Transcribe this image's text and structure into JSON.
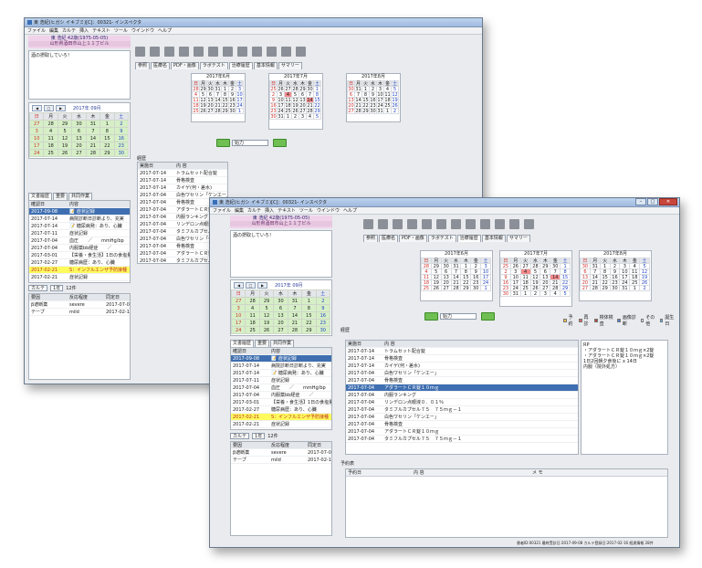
{
  "window": {
    "title": "東 浩紀(ヒガシ イキブミ)[C]：00321- インスペクタ"
  },
  "menu": [
    "ファイル",
    "編集",
    "カルテ",
    "挿入",
    "テキスト",
    "ツール",
    "ウインドウ",
    "ヘルプ"
  ],
  "patient": {
    "name": "東 浩紀 42歳(1975-05-05)",
    "address": "山形県酒田市山上１１丁ビル"
  },
  "memo": "酒の摂取していろ！",
  "tabs": [
    "参照",
    "医療名",
    "PDF・画像",
    "ラボテスト",
    "治療履歴",
    "基本情報",
    "サマリー"
  ],
  "calendar_months": [
    {
      "title": "2017年6月",
      "days": [
        [
          "28",
          "29",
          "30",
          "31",
          "1",
          "2",
          "3"
        ],
        [
          "4",
          "5",
          "6",
          "7",
          "8",
          "9",
          "10"
        ],
        [
          "11",
          "12",
          "13",
          "14",
          "15",
          "16",
          "17"
        ],
        [
          "18",
          "19",
          "20",
          "21",
          "22",
          "23",
          "24"
        ],
        [
          "25",
          "26",
          "27",
          "28",
          "29",
          "30",
          "1"
        ]
      ]
    },
    {
      "title": "2017年7月",
      "days": [
        [
          "25",
          "26",
          "27",
          "28",
          "29",
          "30",
          "1"
        ],
        [
          "2",
          "3",
          "4",
          "5",
          "6",
          "7",
          "8"
        ],
        [
          "9",
          "10",
          "11",
          "12",
          "13",
          "14",
          "15"
        ],
        [
          "16",
          "17",
          "18",
          "19",
          "20",
          "21",
          "22"
        ],
        [
          "23",
          "24",
          "25",
          "26",
          "27",
          "28",
          "29"
        ],
        [
          "30",
          "31",
          "1",
          "2",
          "3",
          "4",
          "5"
        ]
      ]
    },
    {
      "title": "2017年8月",
      "days": [
        [
          "30",
          "31",
          "1",
          "2",
          "3",
          "4",
          "5"
        ],
        [
          "6",
          "7",
          "8",
          "9",
          "10",
          "11",
          "12"
        ],
        [
          "13",
          "14",
          "15",
          "16",
          "17",
          "18",
          "19"
        ],
        [
          "20",
          "21",
          "22",
          "23",
          "24",
          "25",
          "26"
        ],
        [
          "27",
          "28",
          "29",
          "30",
          "31",
          "1",
          "2"
        ]
      ]
    }
  ],
  "weekdays": [
    "日",
    "月",
    "火",
    "水",
    "木",
    "金",
    "土"
  ],
  "side_calendar": {
    "title": "2017年 09月",
    "days": [
      [
        "27",
        "28",
        "29",
        "30",
        "31",
        "1",
        "2"
      ],
      [
        "3",
        "4",
        "5",
        "6",
        "7",
        "8",
        "9"
      ],
      [
        "10",
        "11",
        "12",
        "13",
        "14",
        "15",
        "16"
      ],
      [
        "17",
        "18",
        "19",
        "20",
        "21",
        "22",
        "23"
      ],
      [
        "24",
        "25",
        "26",
        "27",
        "28",
        "29",
        "30"
      ]
    ]
  },
  "bottom_tabs": [
    "文書履歴",
    "重要",
    "共同作業"
  ],
  "doc_list_header": {
    "date": "確認日",
    "text": "内容"
  },
  "doc_list": [
    {
      "date": "2017-09-08",
      "text": "📝 症状記録"
    },
    {
      "date": "2017-07-14",
      "text": "病院診断日診断より、充実"
    },
    {
      "date": "2017-07-14",
      "text": "📝 糖尿病発：あり、心臓"
    },
    {
      "date": "2017-07-11",
      "text": "症状記録"
    },
    {
      "date": "2017-07-04",
      "text": "血圧　　／　　mmHg/bp"
    },
    {
      "date": "2017-07-04",
      "text": "内服薬bb経症　　／"
    },
    {
      "date": "2017-03-01",
      "text": "【栄養・食生活】1日の食塩量"
    },
    {
      "date": "2017-02-27",
      "text": "糖尿病歴：あり、心臓"
    },
    {
      "date": "2017-02-21",
      "text": "S：インフルエンザ予防接種"
    },
    {
      "date": "2017-02-21",
      "text": "症状記録"
    }
  ],
  "controls": {
    "karte": "カルテ",
    "period": "1年",
    "count": "12件"
  },
  "allergy_header": {
    "name": "要因",
    "level": "反応程度",
    "date": "同定日"
  },
  "allergies": [
    {
      "name": "β遮断薬",
      "level": "severe",
      "date": "2017-07-05"
    },
    {
      "name": "テープ",
      "level": "mild",
      "date": "2017-02-16"
    }
  ],
  "period_select": "始力",
  "legend": [
    {
      "label": "予約",
      "color": "#f3c34a"
    },
    {
      "label": "再診",
      "color": "#e36464"
    },
    {
      "label": "検体検査",
      "color": "#b64a3d"
    },
    {
      "label": "画像診断",
      "color": "#4f7fd4"
    },
    {
      "label": "その他",
      "color": "#f0f0f0"
    },
    {
      "label": "誕生日",
      "color": "#55b7e8"
    }
  ],
  "history_label": "経歴",
  "history_header": {
    "date": "実施日",
    "text": "内 容"
  },
  "history": [
    {
      "date": "2017-07-14",
      "text": "トラムセット配合錠"
    },
    {
      "date": "2017-07-14",
      "text": "骨格検査"
    },
    {
      "date": "2017-07-14",
      "text": "カイゲ(何・差水)"
    },
    {
      "date": "2017-07-04",
      "text": "白色ワセリン「ケンエー」"
    },
    {
      "date": "2017-07-04",
      "text": "骨格検査"
    },
    {
      "date": "2017-07-04",
      "text": "アダラートＣＲ錠１０ｍｇ"
    },
    {
      "date": "2017-07-04",
      "text": "内服ランキング"
    },
    {
      "date": "2017-07-04",
      "text": "リンデロン点眼液０．０１％"
    },
    {
      "date": "2017-07-04",
      "text": "タミフルカプセル７５　７５ｍｇ－１"
    },
    {
      "date": "2017-07-04",
      "text": "白色ワセリン「ケンエー」"
    },
    {
      "date": "2017-07-04",
      "text": "骨格検査"
    },
    {
      "date": "2017-07-04",
      "text": "アダラートＣＲ錠１０ｍｇ"
    },
    {
      "date": "2017-07-04",
      "text": "タミフルカプセル７５　７５ｍｇ－１"
    }
  ],
  "rx_detail": [
    "RP",
    "・アダラートＣＲ錠１０ｍｇ×2錠",
    "・アダラートＣＲ錠１０ｍｇ×2錠",
    "1日2回朝夕食後に x 14日",
    "内服（院外処方）"
  ],
  "appointments_label": "予約表",
  "appt_header": {
    "date": "予約日",
    "text": "内 容",
    "memo": "メ モ"
  },
  "status": "患者ID:00321 最終受診日:2017-09-08 カルテ登録日:2017-02-16 経過情報 28件"
}
